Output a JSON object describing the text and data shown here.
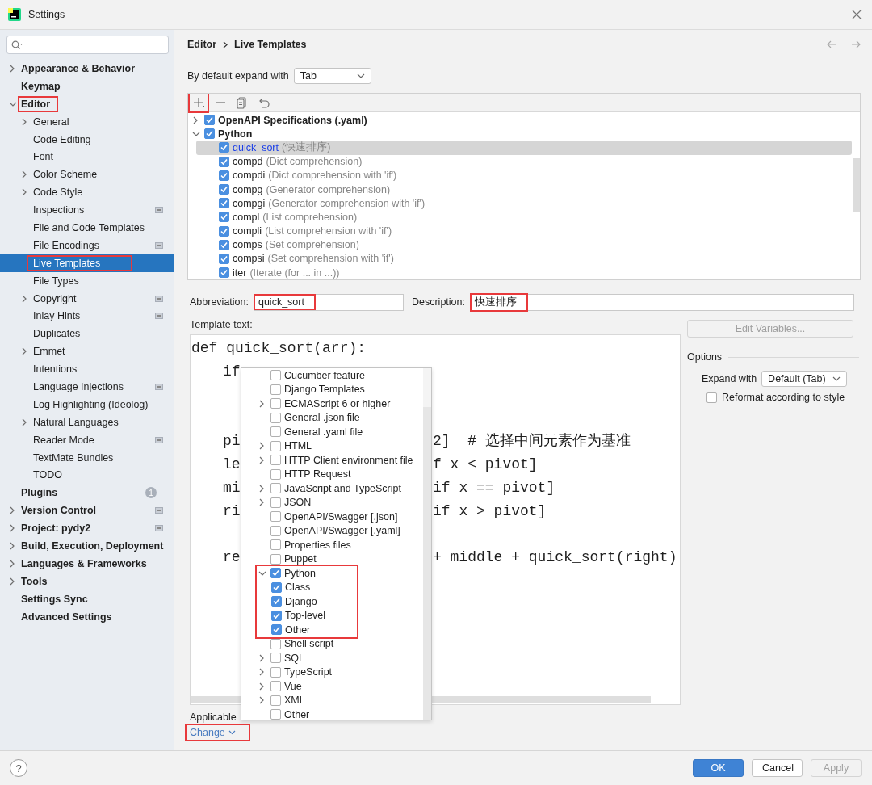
{
  "window": {
    "title": "Settings"
  },
  "sidebar": {
    "items": [
      {
        "label": "Appearance & Behavior",
        "expandable": true,
        "expanded": false,
        "scoped": false,
        "selected": false,
        "highlighted": false
      },
      {
        "label": "Keymap",
        "expandable": false,
        "scoped": false,
        "selected": false,
        "highlighted": false
      },
      {
        "label": "Editor",
        "expandable": true,
        "expanded": true,
        "scoped": false,
        "selected": false,
        "highlighted": true,
        "children": [
          {
            "label": "General",
            "expandable": true,
            "expanded": false,
            "scoped": false,
            "selected": false,
            "highlighted": false
          },
          {
            "label": "Code Editing",
            "expandable": false,
            "scoped": false,
            "selected": false,
            "highlighted": false
          },
          {
            "label": "Font",
            "expandable": false,
            "scoped": false,
            "selected": false,
            "highlighted": false
          },
          {
            "label": "Color Scheme",
            "expandable": true,
            "expanded": false,
            "scoped": false,
            "selected": false,
            "highlighted": false
          },
          {
            "label": "Code Style",
            "expandable": true,
            "expanded": false,
            "scoped": false,
            "selected": false,
            "highlighted": false
          },
          {
            "label": "Inspections",
            "expandable": false,
            "scoped": true,
            "selected": false,
            "highlighted": false
          },
          {
            "label": "File and Code Templates",
            "expandable": false,
            "scoped": false,
            "selected": false,
            "highlighted": false
          },
          {
            "label": "File Encodings",
            "expandable": false,
            "scoped": true,
            "selected": false,
            "highlighted": false
          },
          {
            "label": "Live Templates",
            "expandable": false,
            "scoped": false,
            "selected": true,
            "highlighted": true
          },
          {
            "label": "File Types",
            "expandable": false,
            "scoped": false,
            "selected": false,
            "highlighted": false
          },
          {
            "label": "Copyright",
            "expandable": true,
            "expanded": false,
            "scoped": true,
            "selected": false,
            "highlighted": false
          },
          {
            "label": "Inlay Hints",
            "expandable": false,
            "scoped": true,
            "selected": false,
            "highlighted": false
          },
          {
            "label": "Duplicates",
            "expandable": false,
            "scoped": false,
            "selected": false,
            "highlighted": false
          },
          {
            "label": "Emmet",
            "expandable": true,
            "expanded": false,
            "scoped": false,
            "selected": false,
            "highlighted": false
          },
          {
            "label": "Intentions",
            "expandable": false,
            "scoped": false,
            "selected": false,
            "highlighted": false
          },
          {
            "label": "Language Injections",
            "expandable": false,
            "scoped": true,
            "selected": false,
            "highlighted": false
          },
          {
            "label": "Log Highlighting (Ideolog)",
            "expandable": false,
            "scoped": false,
            "selected": false,
            "highlighted": false
          },
          {
            "label": "Natural Languages",
            "expandable": true,
            "expanded": false,
            "scoped": false,
            "selected": false,
            "highlighted": false
          },
          {
            "label": "Reader Mode",
            "expandable": false,
            "scoped": true,
            "selected": false,
            "highlighted": false
          },
          {
            "label": "TextMate Bundles",
            "expandable": false,
            "scoped": false,
            "selected": false,
            "highlighted": false
          },
          {
            "label": "TODO",
            "expandable": false,
            "scoped": false,
            "selected": false,
            "highlighted": false
          }
        ]
      },
      {
        "label": "Plugins",
        "expandable": false,
        "scoped": false,
        "selected": false,
        "highlighted": false,
        "badge": "1"
      },
      {
        "label": "Version Control",
        "expandable": true,
        "expanded": false,
        "scoped": true,
        "selected": false,
        "highlighted": false
      },
      {
        "label": "Project: pydy2",
        "expandable": true,
        "expanded": false,
        "scoped": true,
        "selected": false,
        "highlighted": false
      },
      {
        "label": "Build, Execution, Deployment",
        "expandable": true,
        "expanded": false,
        "scoped": false,
        "selected": false,
        "highlighted": false
      },
      {
        "label": "Languages & Frameworks",
        "expandable": true,
        "expanded": false,
        "scoped": false,
        "selected": false,
        "highlighted": false
      },
      {
        "label": "Tools",
        "expandable": true,
        "expanded": false,
        "scoped": false,
        "selected": false,
        "highlighted": false
      },
      {
        "label": "Settings Sync",
        "expandable": false,
        "scoped": false,
        "selected": false,
        "highlighted": false
      },
      {
        "label": "Advanced Settings",
        "expandable": false,
        "scoped": false,
        "selected": false,
        "highlighted": false
      }
    ]
  },
  "breadcrumb": [
    "Editor",
    "Live Templates"
  ],
  "expand_default": {
    "label": "By default expand with",
    "value": "Tab"
  },
  "add_button": {
    "highlighted": true
  },
  "templates": [
    {
      "label": "OpenAPI Specifications (.yaml)",
      "expanded": false,
      "checked": true
    },
    {
      "label": "Python",
      "expanded": true,
      "checked": true,
      "children": [
        {
          "abbreviation": "quick_sort",
          "description": "(快速排序)",
          "checked": true,
          "selected": true
        },
        {
          "abbreviation": "compd",
          "description": "(Dict comprehension)",
          "checked": true,
          "selected": false
        },
        {
          "abbreviation": "compdi",
          "description": "(Dict comprehension with 'if')",
          "checked": true,
          "selected": false
        },
        {
          "abbreviation": "compg",
          "description": "(Generator comprehension)",
          "checked": true,
          "selected": false
        },
        {
          "abbreviation": "compgi",
          "description": "(Generator comprehension with 'if')",
          "checked": true,
          "selected": false
        },
        {
          "abbreviation": "compl",
          "description": "(List comprehension)",
          "checked": true,
          "selected": false
        },
        {
          "abbreviation": "compli",
          "description": "(List comprehension with 'if')",
          "checked": true,
          "selected": false
        },
        {
          "abbreviation": "comps",
          "description": "(Set comprehension)",
          "checked": true,
          "selected": false
        },
        {
          "abbreviation": "compsi",
          "description": "(Set comprehension with 'if')",
          "checked": true,
          "selected": false
        },
        {
          "abbreviation": "iter",
          "description": "(Iterate (for ... in ...))",
          "checked": true,
          "selected": false
        }
      ]
    }
  ],
  "abbreviation": {
    "label": "Abbreviation:",
    "value": "quick_sort",
    "highlighted": true
  },
  "description": {
    "label": "Description:",
    "value": "快速排序",
    "highlighted": true
  },
  "template_text": {
    "label": "Template text:",
    "lines": [
      {
        "kind": "code",
        "left": "def quick_sort(arr):",
        "children": [
          {
            "kind": "code",
            "left": "if"
          },
          {
            "kind": "blank"
          },
          {
            "kind": "blank"
          },
          {
            "kind": "code",
            "left": "pi",
            "right": "2]  # 选择中间元素作为基准"
          },
          {
            "kind": "code",
            "left": "le",
            "right": "f x < pivot]"
          },
          {
            "kind": "code",
            "left": "mi",
            "right": "if x == pivot]"
          },
          {
            "kind": "code",
            "left": "ri",
            "right": "if x > pivot]"
          },
          {
            "kind": "blank"
          },
          {
            "kind": "code",
            "left": "re",
            "right": "+ middle + quick_sort(right)"
          }
        ]
      }
    ]
  },
  "contexts": [
    {
      "label": "Cucumber feature",
      "expandable": false,
      "checked": false,
      "highlighted": false
    },
    {
      "label": "Django Templates",
      "expandable": false,
      "checked": false,
      "highlighted": false
    },
    {
      "label": "ECMAScript 6 or higher",
      "expandable": true,
      "expanded": false,
      "checked": false,
      "highlighted": false
    },
    {
      "label": "General .json file",
      "expandable": false,
      "checked": false,
      "highlighted": false
    },
    {
      "label": "General .yaml file",
      "expandable": false,
      "checked": false,
      "highlighted": false
    },
    {
      "label": "HTML",
      "expandable": true,
      "expanded": false,
      "checked": false,
      "highlighted": false
    },
    {
      "label": "HTTP Client environment file",
      "expandable": true,
      "expanded": false,
      "checked": false,
      "highlighted": false
    },
    {
      "label": "HTTP Request",
      "expandable": false,
      "checked": false,
      "highlighted": false
    },
    {
      "label": "JavaScript and TypeScript",
      "expandable": true,
      "expanded": false,
      "checked": false,
      "highlighted": false
    },
    {
      "label": "JSON",
      "expandable": true,
      "expanded": false,
      "checked": false,
      "highlighted": false
    },
    {
      "label": "OpenAPI/Swagger [.json]",
      "expandable": false,
      "checked": false,
      "highlighted": false
    },
    {
      "label": "OpenAPI/Swagger [.yaml]",
      "expandable": false,
      "checked": false,
      "highlighted": false
    },
    {
      "label": "Properties files",
      "expandable": false,
      "checked": false,
      "highlighted": false
    },
    {
      "label": "Puppet",
      "expandable": false,
      "checked": false,
      "highlighted": false
    },
    {
      "label": "Python",
      "expandable": true,
      "expanded": true,
      "checked": true,
      "highlighted": true,
      "children": [
        {
          "label": "Class",
          "checked": true
        },
        {
          "label": "Django",
          "checked": true
        },
        {
          "label": "Top-level",
          "checked": true
        },
        {
          "label": "Other",
          "checked": true
        }
      ]
    },
    {
      "label": "Shell script",
      "expandable": false,
      "checked": false,
      "highlighted": false
    },
    {
      "label": "SQL",
      "expandable": true,
      "expanded": false,
      "checked": false,
      "highlighted": false
    },
    {
      "label": "TypeScript",
      "expandable": true,
      "expanded": false,
      "checked": false,
      "highlighted": false
    },
    {
      "label": "Vue",
      "expandable": true,
      "expanded": false,
      "checked": false,
      "highlighted": false
    },
    {
      "label": "XML",
      "expandable": true,
      "expanded": false,
      "checked": false,
      "highlighted": false
    },
    {
      "label": "Other",
      "expandable": false,
      "checked": false,
      "highlighted": false
    }
  ],
  "applicable": {
    "label": "Applicable",
    "link": "Change",
    "highlighted": true
  },
  "edit_variables": {
    "label": "Edit Variables...",
    "disabled": true
  },
  "options": {
    "title": "Options",
    "expand_with": {
      "label": "Expand with",
      "value": "Default (Tab)"
    },
    "reformat": {
      "label": "Reformat according to style",
      "checked": false
    }
  },
  "help": "?",
  "buttons": [
    {
      "label": "OK",
      "kind": "primary"
    },
    {
      "label": "Cancel",
      "kind": "default"
    },
    {
      "label": "Apply",
      "kind": "disabled"
    }
  ]
}
